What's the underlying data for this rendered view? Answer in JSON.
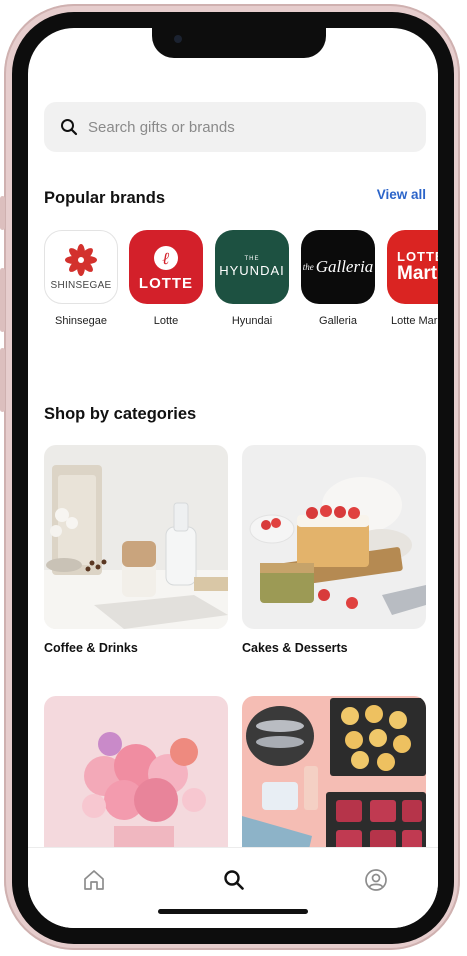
{
  "search": {
    "placeholder": "Search gifts or brands"
  },
  "brands_section": {
    "title": "Popular brands",
    "view_all": "View all",
    "items": [
      {
        "name": "Shinsegae",
        "logo_text": "SHINSEGAE",
        "bg": "#ffffff",
        "accent": "#d3312d"
      },
      {
        "name": "Lotte",
        "logo_text": "LOTTE",
        "bg": "#d3202a",
        "accent": "#ffffff"
      },
      {
        "name": "Hyundai",
        "logo_text": "HYUNDAI",
        "logo_small": "THE",
        "bg": "#1d5141",
        "accent": "#ffffff"
      },
      {
        "name": "Galleria",
        "logo_text": "Galleria",
        "logo_small": "the",
        "bg": "#0b0b0b",
        "accent": "#ffffff"
      },
      {
        "name": "Lotte Mar",
        "logo_text": "LOTTE",
        "logo_text2": "Mart",
        "bg": "#da2422",
        "accent": "#ffffff"
      }
    ]
  },
  "categories_section": {
    "title": "Shop by categories",
    "items": [
      {
        "label": "Coffee & Drinks"
      },
      {
        "label": "Cakes & Desserts"
      },
      {
        "label": ""
      },
      {
        "label": ""
      }
    ]
  },
  "nav": {
    "home": "home-icon",
    "search": "search-icon",
    "profile": "profile-icon"
  }
}
